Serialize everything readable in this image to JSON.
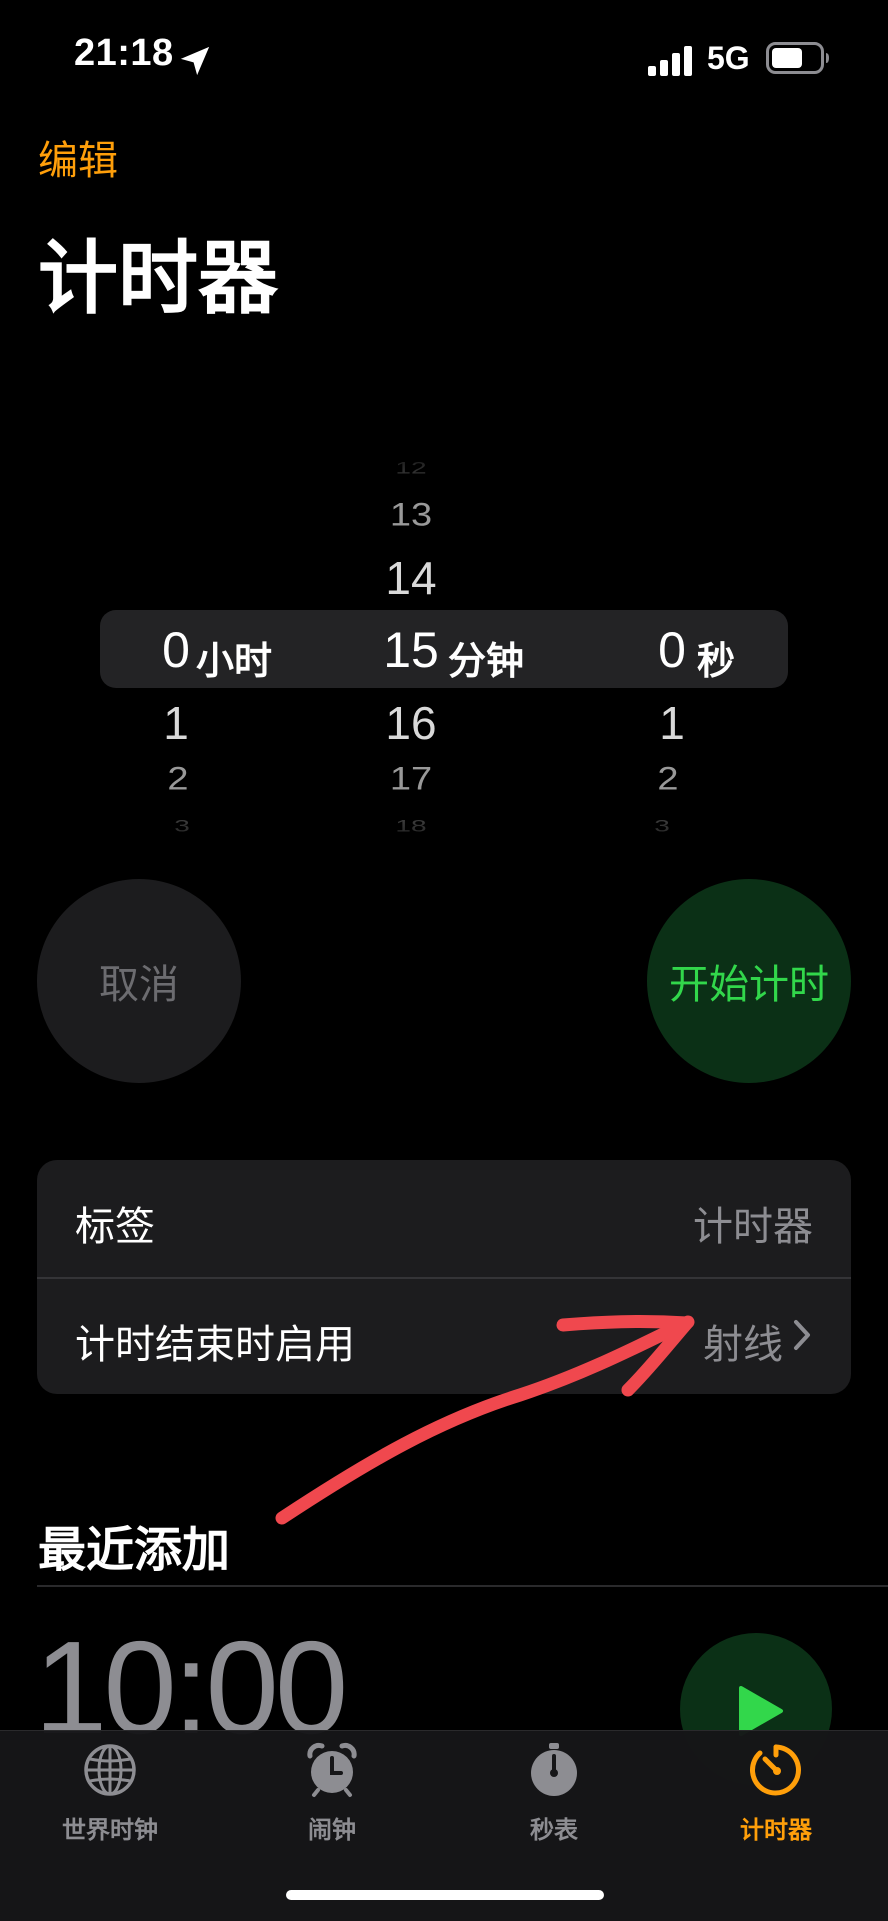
{
  "status_bar": {
    "time": "21:18",
    "network": "5G",
    "icons": [
      "location-arrow-icon",
      "cellular-signal-icon",
      "battery-icon"
    ]
  },
  "header": {
    "edit": "编辑",
    "title": "计时器"
  },
  "picker": {
    "hours": {
      "above": [
        "",
        "",
        ""
      ],
      "selected": "0",
      "unit": "小时",
      "below": [
        "1",
        "2",
        "3"
      ]
    },
    "minutes": {
      "above": [
        "12",
        "13",
        "14"
      ],
      "selected": "15",
      "unit": "分钟",
      "below": [
        "16",
        "17",
        "18"
      ]
    },
    "seconds": {
      "above": [
        "",
        "",
        ""
      ],
      "selected": "0",
      "unit": "秒",
      "below": [
        "1",
        "2",
        "3"
      ]
    }
  },
  "actions": {
    "cancel": "取消",
    "start": "开始计时"
  },
  "settings": {
    "label_row": {
      "label": "标签",
      "value": "计时器"
    },
    "end_row": {
      "label": "计时结束时启用",
      "value": "射线"
    }
  },
  "recents": {
    "title": "最近添加",
    "items": [
      {
        "time": "10:00"
      }
    ]
  },
  "tabs": [
    {
      "label": "世界时钟",
      "icon": "globe-icon",
      "active": false
    },
    {
      "label": "闹钟",
      "icon": "alarm-clock-icon",
      "active": false
    },
    {
      "label": "秒表",
      "icon": "stopwatch-icon",
      "active": false
    },
    {
      "label": "计时器",
      "icon": "timer-icon",
      "active": true
    }
  ],
  "colors": {
    "accent": "#ff9f0a",
    "start_green": "#32d74b",
    "start_bg": "#0b3016",
    "annotation": "#f0484e"
  }
}
